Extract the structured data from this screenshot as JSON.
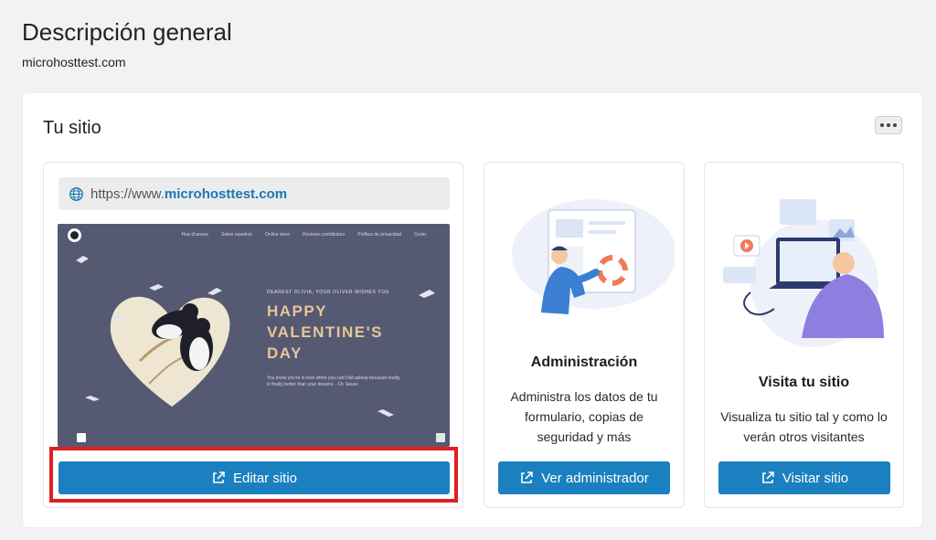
{
  "page": {
    "title": "Descripción general",
    "subtitle": "microhosttest.com"
  },
  "panel": {
    "title": "Tu sitio",
    "more_icon": "ellipsis-icon"
  },
  "site_card": {
    "url_prefix": "https://www.",
    "url_domain": "microhosttest.com",
    "edit_button": "Editar sitio",
    "preview": {
      "nav": [
        "Hoe d'ussure",
        "Sobre nosotros",
        "Online store",
        "Reviews contributors",
        "Política de privacidad",
        "Cesto"
      ],
      "subheading": "DEAREST OLIVIA, YOUR OLIVER WISHES YOU",
      "heading_lines": [
        "HAPPY",
        "VALENTINE'S",
        "DAY"
      ],
      "body": "You know you're in love when you can't fall asleep because reality is finally better than your dreams. - Dr. Seuss"
    }
  },
  "admin_card": {
    "heading": "Administración",
    "description": "Administra los datos de tu formulario, copias de seguridad y más",
    "button": "Ver administrador"
  },
  "visit_card": {
    "heading": "Visita tu sitio",
    "description": "Visualiza tu sitio tal y como lo verán otros visitantes",
    "button": "Visitar sitio"
  },
  "colors": {
    "accent": "#1b80bf",
    "link": "#1b78b6",
    "highlight": "#e01f1f",
    "preview_bg": "#555a72",
    "preview_heading": "#e8c49a"
  }
}
